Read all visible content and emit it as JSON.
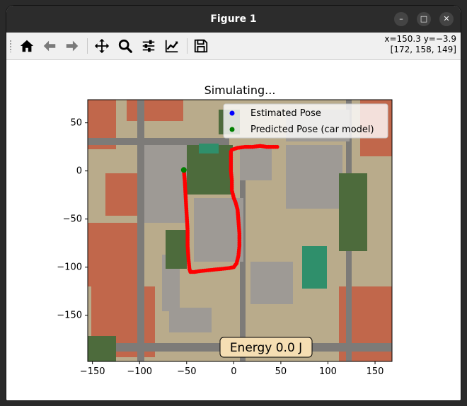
{
  "window": {
    "title": "Figure 1",
    "controls": [
      "–",
      "□",
      "✕"
    ]
  },
  "toolbar": {
    "buttons": [
      {
        "name": "home-button",
        "icon": "home-icon"
      },
      {
        "name": "back-button",
        "icon": "arrow-left-icon"
      },
      {
        "name": "forward-button",
        "icon": "arrow-right-icon"
      },
      {
        "name": "pan-button",
        "icon": "move-icon"
      },
      {
        "name": "zoom-button",
        "icon": "magnifier-icon"
      },
      {
        "name": "configure-subplots-button",
        "icon": "sliders-icon"
      },
      {
        "name": "edit-axis-button",
        "icon": "line-chart-icon"
      },
      {
        "name": "save-button",
        "icon": "floppy-disk-icon"
      }
    ],
    "coord_line1": "x=150.3 y=−3.9",
    "coord_line2": "[172, 158, 149]"
  },
  "chart_data": {
    "type": "scatter",
    "title": "Simulating...",
    "xlim": [
      -155,
      168
    ],
    "ylim": [
      -198,
      74
    ],
    "xticks": [
      -150,
      -100,
      -50,
      0,
      50,
      100,
      150
    ],
    "yticks": [
      50,
      0,
      -50,
      -100,
      -150
    ],
    "legend_position": "top-right",
    "series": [
      {
        "name": "Estimated Pose",
        "color": "#0000ff",
        "x": [],
        "y": []
      },
      {
        "name": "Predicted Pose (car model)",
        "color": "#008000",
        "x": [
          -53
        ],
        "y": [
          1
        ]
      }
    ],
    "path": {
      "color": "#ff0000",
      "x": [
        -53,
        -52,
        -51,
        -50,
        -49,
        -49,
        -48,
        -47,
        -46,
        -42,
        -35,
        -25,
        -15,
        -5,
        0,
        3,
        5,
        6,
        6,
        5,
        4,
        2,
        0,
        -1,
        -2,
        -2,
        -3,
        -3,
        -3,
        -2,
        4,
        12,
        20,
        28,
        35,
        48
      ],
      "y": [
        1,
        -10,
        -28,
        -45,
        -62,
        -78,
        -92,
        -102,
        -105,
        -105,
        -104,
        -103,
        -102,
        -101,
        -100,
        -96,
        -88,
        -78,
        -65,
        -52,
        -40,
        -33,
        -28,
        -24,
        -20,
        -10,
        0,
        10,
        20,
        22,
        24,
        25,
        25,
        26,
        25,
        25
      ]
    },
    "energy_label": "Energy 0.0 J",
    "map_colors": {
      "buildings": "#9e9a95",
      "roofs": "#c1674b",
      "vegetation": "#4d6b3c",
      "roads": "#7d7b78",
      "plaza": "#b9ab8b",
      "court": "#2f8f6b"
    }
  }
}
